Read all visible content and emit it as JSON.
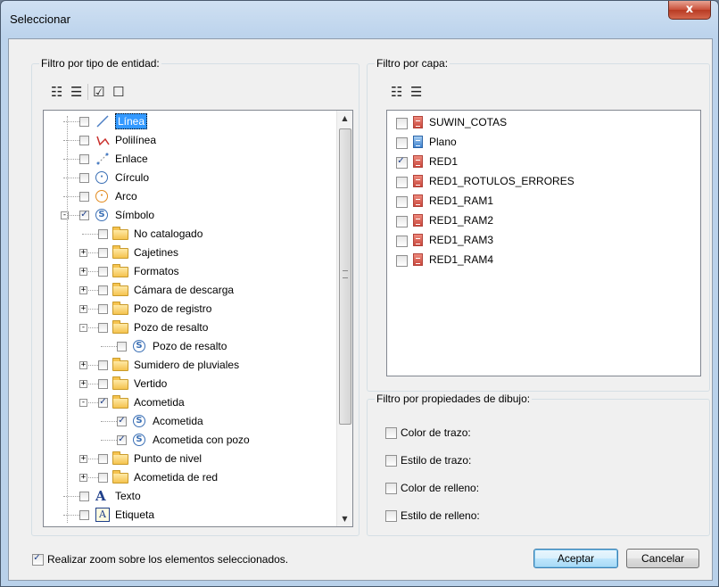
{
  "window": {
    "title": "Seleccionar",
    "close_label": "x"
  },
  "entity_filter": {
    "label": "Filtro por tipo de entidad:",
    "tree": [
      {
        "label": "Línea",
        "icon": "line-icon",
        "checked": false,
        "level": 0,
        "expander": "",
        "selected": true
      },
      {
        "label": "Polilínea",
        "icon": "polyline-icon",
        "checked": false,
        "level": 0,
        "expander": ""
      },
      {
        "label": "Enlace",
        "icon": "link-icon",
        "checked": false,
        "level": 0,
        "expander": ""
      },
      {
        "label": "Círculo",
        "icon": "circle-icon",
        "checked": false,
        "level": 0,
        "expander": ""
      },
      {
        "label": "Arco",
        "icon": "arc-icon",
        "checked": false,
        "level": 0,
        "expander": ""
      },
      {
        "label": "Símbolo",
        "icon": "symbol-icon",
        "checked": true,
        "level": 0,
        "expander": "-"
      },
      {
        "label": "No catalogado",
        "icon": "folder-icon",
        "checked": false,
        "level": 1,
        "expander": ""
      },
      {
        "label": "Cajetines",
        "icon": "folder-icon",
        "checked": false,
        "level": 1,
        "expander": "+"
      },
      {
        "label": "Formatos",
        "icon": "folder-icon",
        "checked": false,
        "level": 1,
        "expander": "+"
      },
      {
        "label": "Cámara de descarga",
        "icon": "folder-icon",
        "checked": false,
        "level": 1,
        "expander": "+"
      },
      {
        "label": "Pozo de registro",
        "icon": "folder-icon",
        "checked": false,
        "level": 1,
        "expander": "+"
      },
      {
        "label": "Pozo de resalto",
        "icon": "folder-open-icon",
        "checked": false,
        "level": 1,
        "expander": "-"
      },
      {
        "label": "Pozo de resalto",
        "icon": "symbol-icon",
        "checked": false,
        "level": 2,
        "expander": ""
      },
      {
        "label": "Sumidero de pluviales",
        "icon": "folder-icon",
        "checked": false,
        "level": 1,
        "expander": "+"
      },
      {
        "label": "Vertido",
        "icon": "folder-icon",
        "checked": false,
        "level": 1,
        "expander": "+"
      },
      {
        "label": "Acometida",
        "icon": "folder-open-icon",
        "checked": true,
        "level": 1,
        "expander": "-"
      },
      {
        "label": "Acometida",
        "icon": "symbol-icon",
        "checked": true,
        "level": 2,
        "expander": ""
      },
      {
        "label": "Acometida con pozo",
        "icon": "symbol-icon",
        "checked": true,
        "level": 2,
        "expander": ""
      },
      {
        "label": "Punto de nivel",
        "icon": "folder-icon",
        "checked": false,
        "level": 1,
        "expander": "+"
      },
      {
        "label": "Acometida de red",
        "icon": "folder-icon",
        "checked": false,
        "level": 1,
        "expander": "+"
      },
      {
        "label": "Texto",
        "icon": "text-icon",
        "checked": false,
        "level": 0,
        "expander": ""
      },
      {
        "label": "Etiqueta",
        "icon": "label-icon",
        "checked": false,
        "level": 0,
        "expander": ""
      }
    ]
  },
  "layer_filter": {
    "label": "Filtro por capa:",
    "layers": [
      {
        "label": "SUWIN_COTAS",
        "checked": false,
        "color": "red"
      },
      {
        "label": "Plano",
        "checked": false,
        "color": "blue"
      },
      {
        "label": "RED1",
        "checked": true,
        "color": "red"
      },
      {
        "label": "RED1_ROTULOS_ERRORES",
        "checked": false,
        "color": "red"
      },
      {
        "label": "RED1_RAM1",
        "checked": false,
        "color": "red"
      },
      {
        "label": "RED1_RAM2",
        "checked": false,
        "color": "red"
      },
      {
        "label": "RED1_RAM3",
        "checked": false,
        "color": "red"
      },
      {
        "label": "RED1_RAM4",
        "checked": false,
        "color": "red"
      }
    ]
  },
  "drawing_filter": {
    "label": "Filtro por propiedades de dibujo:",
    "options": [
      {
        "label": "Color de trazo:",
        "checked": false
      },
      {
        "label": "Estilo de trazo:",
        "checked": false
      },
      {
        "label": "Color de relleno:",
        "checked": false
      },
      {
        "label": "Estilo de relleno:",
        "checked": false
      }
    ]
  },
  "zoom_option": {
    "label": "Realizar zoom sobre los elementos seleccionados.",
    "checked": true
  },
  "buttons": {
    "accept": "Aceptar",
    "cancel": "Cancelar"
  },
  "colors": {
    "accent": "#3399ff",
    "window_frame": "#b9d1ea",
    "close_red": "#c9503a"
  }
}
